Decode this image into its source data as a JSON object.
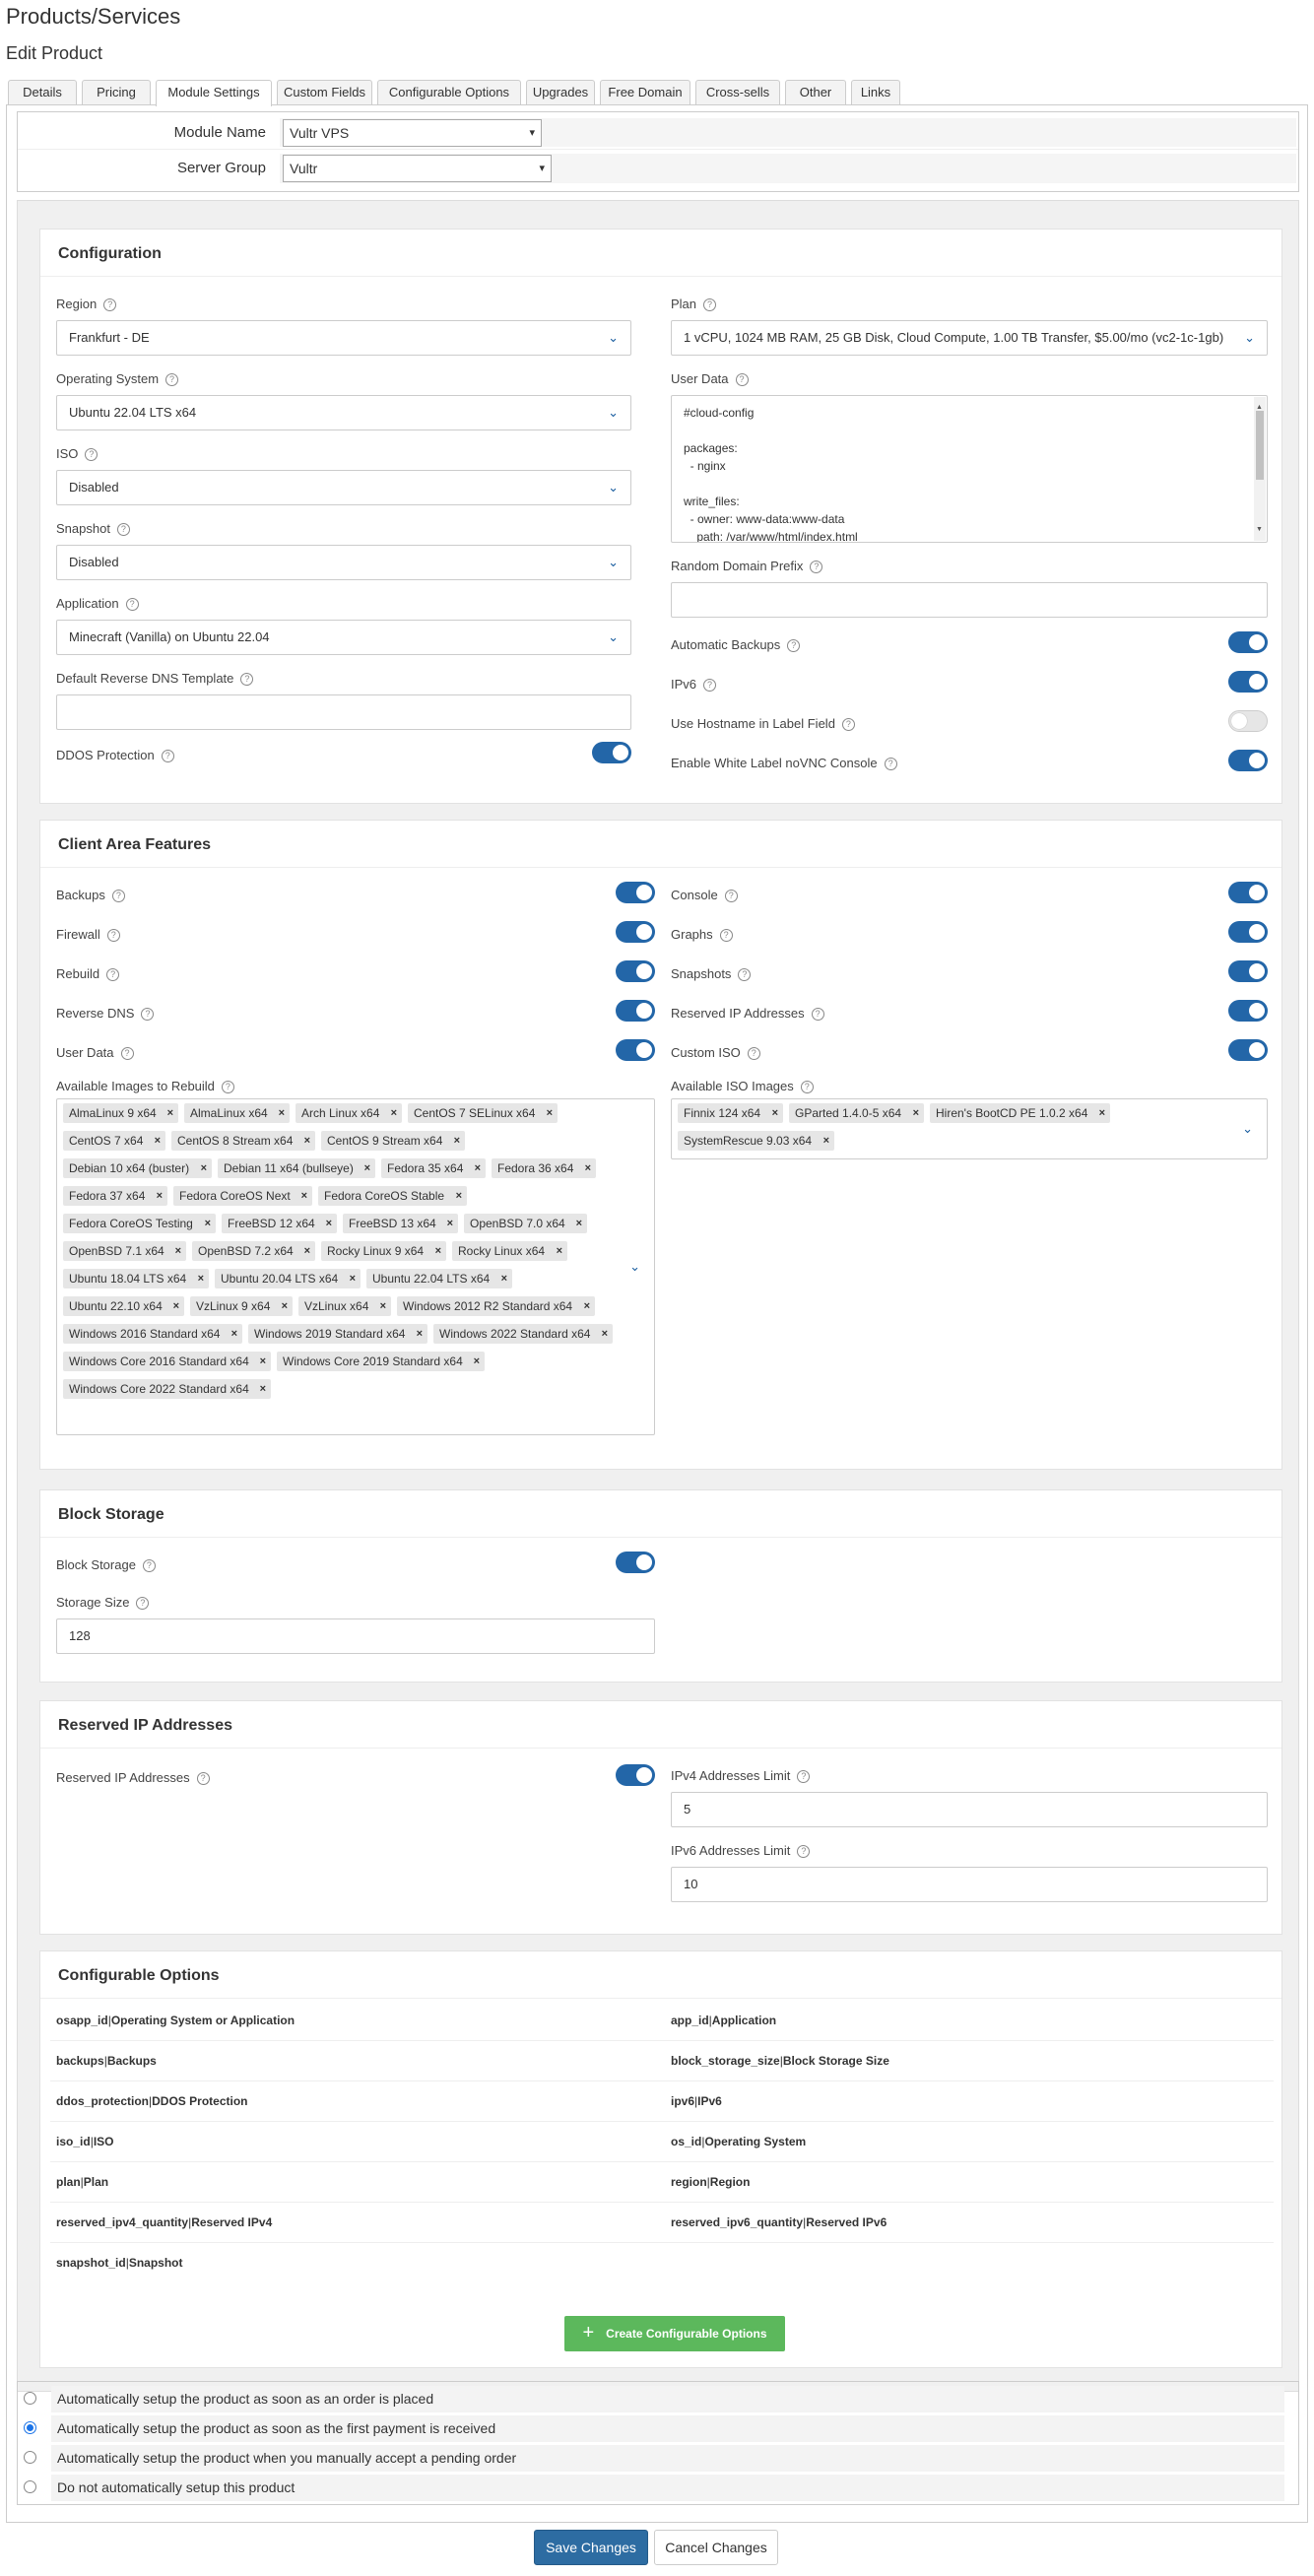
{
  "page": {
    "title": "Products/Services",
    "subtitle": "Edit Product"
  },
  "tabs": [
    "Details",
    "Pricing",
    "Module Settings",
    "Custom Fields",
    "Configurable Options",
    "Upgrades",
    "Free Domain",
    "Cross-sells",
    "Other",
    "Links"
  ],
  "active_tab": "Module Settings",
  "module": {
    "name_label": "Module Name",
    "name_value": "Vultr VPS",
    "group_label": "Server Group",
    "group_value": "Vultr"
  },
  "configuration": {
    "title": "Configuration",
    "region": {
      "label": "Region",
      "value": "Frankfurt - DE"
    },
    "os": {
      "label": "Operating System",
      "value": "Ubuntu 22.04 LTS x64"
    },
    "iso": {
      "label": "ISO",
      "value": "Disabled"
    },
    "snapshot": {
      "label": "Snapshot",
      "value": "Disabled"
    },
    "application": {
      "label": "Application",
      "value": "Minecraft (Vanilla) on Ubuntu 22.04"
    },
    "rdns": {
      "label": "Default Reverse DNS Template",
      "value": ""
    },
    "ddos": {
      "label": "DDOS Protection",
      "on": true
    },
    "plan": {
      "label": "Plan",
      "value": "1 vCPU, 1024 MB RAM, 25 GB Disk, Cloud Compute, 1.00 TB Transfer, $5.00/mo (vc2-1c-1gb)"
    },
    "userdata": {
      "label": "User Data",
      "lines": [
        "#cloud-config",
        "",
        "packages:",
        "  - nginx",
        "",
        "write_files:",
        "  - owner: www-data:www-data",
        "    path: /var/www/html/index.html"
      ]
    },
    "prefix": {
      "label": "Random Domain Prefix",
      "value": ""
    },
    "backups": {
      "label": "Automatic Backups",
      "on": true
    },
    "ipv6": {
      "label": "IPv6",
      "on": true
    },
    "hostname": {
      "label": "Use Hostname in Label Field",
      "on": false
    },
    "novnc": {
      "label": "Enable White Label noVNC Console",
      "on": true
    }
  },
  "client_area": {
    "title": "Client Area Features",
    "left": [
      {
        "label": "Backups",
        "on": true
      },
      {
        "label": "Firewall",
        "on": true
      },
      {
        "label": "Rebuild",
        "on": true
      },
      {
        "label": "Reverse DNS",
        "on": true
      },
      {
        "label": "User Data",
        "on": true
      }
    ],
    "right": [
      {
        "label": "Console",
        "on": true
      },
      {
        "label": "Graphs",
        "on": true
      },
      {
        "label": "Snapshots",
        "on": true
      },
      {
        "label": "Reserved IP Addresses",
        "on": true
      },
      {
        "label": "Custom ISO",
        "on": true
      }
    ],
    "images_label": "Available Images to Rebuild",
    "images": [
      "AlmaLinux 9 x64",
      "AlmaLinux x64",
      "Arch Linux x64",
      "CentOS 7 SELinux x64",
      "CentOS 7 x64",
      "CentOS 8 Stream x64",
      "CentOS 9 Stream x64",
      "Debian 10 x64 (buster)",
      "Debian 11 x64 (bullseye)",
      "Fedora 35 x64",
      "Fedora 36 x64",
      "Fedora 37 x64",
      "Fedora CoreOS Next",
      "Fedora CoreOS Stable",
      "Fedora CoreOS Testing",
      "FreeBSD 12 x64",
      "FreeBSD 13 x64",
      "OpenBSD 7.0 x64",
      "OpenBSD 7.1 x64",
      "OpenBSD 7.2 x64",
      "Rocky Linux 9 x64",
      "Rocky Linux x64",
      "Ubuntu 18.04 LTS x64",
      "Ubuntu 20.04 LTS x64",
      "Ubuntu 22.04 LTS x64",
      "Ubuntu 22.10 x64",
      "VzLinux 9 x64",
      "VzLinux x64",
      "Windows 2012 R2 Standard x64",
      "Windows 2016 Standard x64",
      "Windows 2019 Standard x64",
      "Windows 2022 Standard x64",
      "Windows Core 2016 Standard x64",
      "Windows Core 2019 Standard x64",
      "Windows Core 2022 Standard x64"
    ],
    "iso_label": "Available ISO Images",
    "isos": [
      "Finnix 124 x64",
      "GParted 1.4.0-5 x64",
      "Hiren's BootCD PE 1.0.2 x64",
      "SystemRescue 9.03 x64"
    ]
  },
  "block_storage": {
    "title": "Block Storage",
    "toggle_label": "Block Storage",
    "on": true,
    "size_label": "Storage Size",
    "size": "128"
  },
  "reserved_ip": {
    "title": "Reserved IP Addresses",
    "toggle_label": "Reserved IP Addresses",
    "on": true,
    "ipv4_label": "IPv4 Addresses Limit",
    "ipv4": "5",
    "ipv6_label": "IPv6 Addresses Limit",
    "ipv6": "10"
  },
  "configurable": {
    "title": "Configurable Options",
    "rows": [
      [
        {
          "key": "osapp_id",
          "name": "Operating System or Application"
        },
        {
          "key": "app_id",
          "name": "Application"
        }
      ],
      [
        {
          "key": "backups",
          "name": "Backups"
        },
        {
          "key": "block_storage_size",
          "name": "Block Storage Size"
        }
      ],
      [
        {
          "key": "ddos_protection",
          "name": "DDOS Protection"
        },
        {
          "key": "ipv6",
          "name": "IPv6"
        }
      ],
      [
        {
          "key": "iso_id",
          "name": "ISO"
        },
        {
          "key": "os_id",
          "name": "Operating System"
        }
      ],
      [
        {
          "key": "plan",
          "name": "Plan"
        },
        {
          "key": "region",
          "name": "Region"
        }
      ],
      [
        {
          "key": "reserved_ipv4_quantity",
          "name": "Reserved IPv4"
        },
        {
          "key": "reserved_ipv6_quantity",
          "name": "Reserved IPv6"
        }
      ],
      [
        {
          "key": "snapshot_id",
          "name": "Snapshot"
        }
      ]
    ],
    "create_button": "Create Configurable Options"
  },
  "autosetup": {
    "options": [
      "Automatically setup the product as soon as an order is placed",
      "Automatically setup the product as soon as the first payment is received",
      "Automatically setup the product when you manually accept a pending order",
      "Do not automatically setup this product"
    ],
    "selected": 1
  },
  "actions": {
    "save": "Save Changes",
    "cancel": "Cancel Changes"
  },
  "colors": {
    "primary": "#2366a8",
    "success": "#5cb85c"
  }
}
